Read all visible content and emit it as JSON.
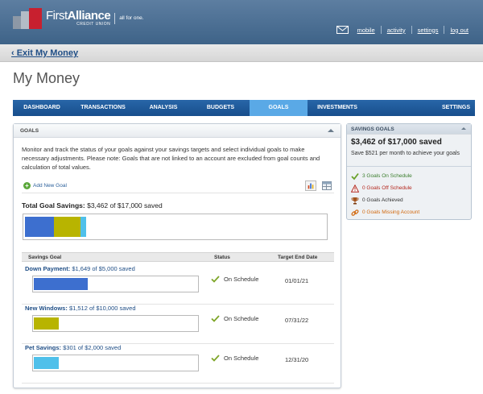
{
  "brand": {
    "name_light": "First",
    "name_bold": "Alliance",
    "sub": "CREDIT UNION",
    "tagline": "all for one."
  },
  "header": {
    "links": [
      "mobile",
      "activity",
      "settings",
      "log out"
    ],
    "mail_icon": "envelope-icon"
  },
  "exit": {
    "label": "‹ Exit My Money"
  },
  "page": {
    "title": "My Money"
  },
  "nav": {
    "tabs": [
      "DASHBOARD",
      "TRANSACTIONS",
      "ANALYSIS",
      "BUDGETS",
      "GOALS",
      "INVESTMENTS"
    ],
    "active": "GOALS",
    "settings": "SETTINGS"
  },
  "goals_panel": {
    "title": "GOALS",
    "description": "Monitor and track the status of your goals against your savings targets and select individual goals to make necessary adjustments. Please note: Goals that are not linked to an account are excluded from goal counts and calculation of total values.",
    "add_goal": "Add New Goal",
    "total_label": "Total Goal Savings:",
    "total_value": "$3,462 of $17,000 saved",
    "total_segments": [
      {
        "goal": "Down Payment",
        "saved": 1649,
        "color": "#3d6fcf"
      },
      {
        "goal": "New Windows",
        "saved": 1512,
        "color": "#b8b400"
      },
      {
        "goal": "Pet Savings",
        "saved": 301,
        "color": "#4fc0ea"
      }
    ],
    "total_target": 17000,
    "columns": [
      "Savings Goal",
      "Status",
      "Target End Date"
    ],
    "goals": [
      {
        "name": "Down Payment:",
        "amount": "$1,649 of $5,000 saved",
        "saved": 1649,
        "target": 5000,
        "color": "#3d6fcf",
        "status": "On Schedule",
        "date": "01/01/21"
      },
      {
        "name": "New Windows:",
        "amount": "$1,512 of $10,000 saved",
        "saved": 1512,
        "target": 10000,
        "color": "#b8b400",
        "status": "On Schedule",
        "date": "07/31/22"
      },
      {
        "name": "Pet Savings:",
        "amount": "$301 of $2,000 saved",
        "saved": 301,
        "target": 2000,
        "color": "#4fc0ea",
        "status": "On Schedule",
        "date": "12/31/20"
      }
    ]
  },
  "savings_goals": {
    "title": "SAVINGS GOALS",
    "amount": "$3,462 of $17,000 saved",
    "sub": "Save $521 per month to achieve your goals",
    "items": [
      {
        "label": "3 Goals On Schedule",
        "icon": "green-check-icon",
        "color": "#3a7d2c"
      },
      {
        "label": "0 Goals Off Schedule",
        "icon": "warning-triangle-icon",
        "color": "#b4281e"
      },
      {
        "label": "0 Goals Achieved",
        "icon": "trophy-icon",
        "color": "#333333"
      },
      {
        "label": "0 Goals Missing Account",
        "icon": "broken-link-icon",
        "color": "#d2690f"
      }
    ]
  }
}
